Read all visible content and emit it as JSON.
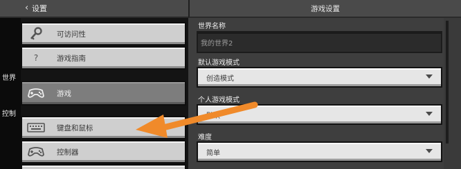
{
  "header": {
    "back_label": "设置",
    "title": "游戏设置"
  },
  "sidebar": {
    "sections": [
      {
        "title": ""
      },
      {
        "title": "世界"
      },
      {
        "title": "控制"
      }
    ],
    "items": [
      {
        "label": "可访问性",
        "icon": "key-icon",
        "selected": false
      },
      {
        "label": "游戏指南",
        "icon": "question-icon",
        "selected": false
      },
      {
        "label": "游戏",
        "icon": "gamepad-icon",
        "selected": true
      },
      {
        "label": "键盘和鼠标",
        "icon": "keyboard-icon",
        "selected": false
      },
      {
        "label": "控制器",
        "icon": "gamepad-icon",
        "selected": false
      }
    ]
  },
  "main": {
    "world_name": {
      "label": "世界名称",
      "value": "我的世界2"
    },
    "default_game_mode": {
      "label": "默认游戏模式",
      "value": "创造模式"
    },
    "personal_game_mode": {
      "label": "个人游戏模式",
      "value": "默认"
    },
    "difficulty": {
      "label": "难度",
      "value": "简单"
    }
  },
  "annotation": {
    "color": "#f08a2a",
    "icon": "arrow-annotation"
  }
}
